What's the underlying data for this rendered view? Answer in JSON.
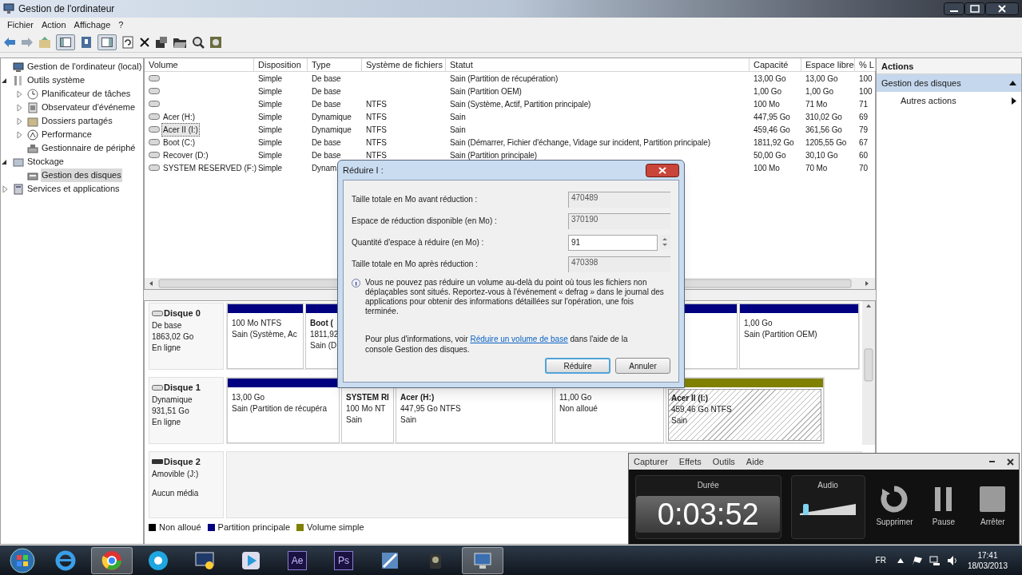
{
  "window": {
    "title": "Gestion de l'ordinateur"
  },
  "menu": [
    "Fichier",
    "Action",
    "Affichage",
    "?"
  ],
  "toolbar": {
    "console_tree_shown": true,
    "action_pane_shown": true
  },
  "tree": [
    {
      "label": "Gestion de l'ordinateur (local)",
      "kind": "computer",
      "selected": false,
      "children": [
        {
          "label": "Outils système",
          "kind": "tools",
          "expanded": true,
          "selected": false,
          "children": [
            {
              "label": "Planificateur de tâches",
              "kind": "clock",
              "expanded": false,
              "selected": false
            },
            {
              "label": "Observateur d'événeme",
              "kind": "log",
              "expanded": false,
              "selected": false
            },
            {
              "label": "Dossiers partagés",
              "kind": "share",
              "expanded": false,
              "selected": false
            },
            {
              "label": "Performance",
              "kind": "perf",
              "expanded": false,
              "selected": false
            },
            {
              "label": "Gestionnaire de périphé",
              "kind": "devices",
              "selected": false
            }
          ]
        },
        {
          "label": "Stockage",
          "kind": "storage",
          "expanded": true,
          "selected": false,
          "children": [
            {
              "label": "Gestion des disques",
              "kind": "disk",
              "selected": true
            }
          ]
        },
        {
          "label": "Services et applications",
          "kind": "services",
          "expanded": false,
          "selected": false
        }
      ]
    }
  ],
  "table": {
    "columns": [
      "Volume",
      "Disposition",
      "Type",
      "Système de fichiers",
      "Statut",
      "Capacité",
      "Espace libre",
      "% L"
    ],
    "rows": [
      {
        "selected": false,
        "layout": "Simple",
        "type": "De base",
        "status": "Sain (Partition de récupération)",
        "capacity": "13,00 Go",
        "free": "13,00 Go",
        "pct": "100"
      },
      {
        "selected": false,
        "layout": "Simple",
        "type": "De base",
        "status": "Sain (Partition OEM)",
        "capacity": "1,00 Go",
        "free": "1,00 Go",
        "pct": "100"
      },
      {
        "selected": false,
        "layout": "Simple",
        "type": "De base",
        "fs": "NTFS",
        "status": "Sain (Système, Actif, Partition principale)",
        "capacity": "100 Mo",
        "free": "71 Mo",
        "pct": "71"
      },
      {
        "selected": false,
        "volume": "Acer (H:)",
        "layout": "Simple",
        "type": "Dynamique",
        "fs": "NTFS",
        "status": "Sain",
        "capacity": "447,95 Go",
        "free": "310,02 Go",
        "pct": "69"
      },
      {
        "selected": true,
        "volume": "Acer II (I:)",
        "layout": "Simple",
        "type": "Dynamique",
        "fs": "NTFS",
        "status": "Sain",
        "capacity": "459,46 Go",
        "free": "361,56 Go",
        "pct": "79"
      },
      {
        "selected": false,
        "volume": "Boot (C:)",
        "layout": "Simple",
        "type": "De base",
        "fs": "NTFS",
        "status": "Sain (Démarrer, Fichier d'échange, Vidage sur incident, Partition principale)",
        "capacity": "1811,92 Go",
        "free": "1205,55 Go",
        "pct": "67"
      },
      {
        "selected": false,
        "volume": "Recover (D:)",
        "layout": "Simple",
        "type": "De base",
        "fs": "NTFS",
        "status": "Sain (Partition principale)",
        "capacity": "50,00 Go",
        "free": "30,10 Go",
        "pct": "60"
      },
      {
        "selected": false,
        "volume": "SYSTEM RESERVED (F:)",
        "layout": "Simple",
        "type": "Dynam",
        "capacity": "100 Mo",
        "free": "70 Mo",
        "pct": "70"
      }
    ]
  },
  "disks": [
    {
      "kind": "hdd",
      "name": "Disque 0",
      "lines": [
        "De base",
        "1863,02 Go",
        "En ligne"
      ],
      "partitions": [
        {
          "color": "#000080",
          "selected": false,
          "lines": [
            "100 Mo NTFS",
            "Sain (Système, Ac"
          ]
        },
        {
          "color": "#000080",
          "selected": false,
          "name": "Boot (",
          "lines": [
            "1811,92",
            "Sain (D"
          ]
        },
        {
          "color": "#000080",
          "selected": false
        },
        {
          "color": "#000080",
          "selected": false,
          "lines": [
            "1,00 Go",
            "Sain (Partition OEM)"
          ]
        }
      ]
    },
    {
      "kind": "hdd",
      "name": "Disque 1",
      "lines": [
        "Dynamique",
        "931,51 Go",
        "En ligne"
      ],
      "partitions": [
        {
          "color": "#000080",
          "selected": false,
          "lines": [
            "13,00 Go",
            "Sain (Partition de récupéra"
          ]
        },
        {
          "selected": false,
          "name": "SYSTEM RI",
          "lines": [
            "100 Mo NT",
            "Sain"
          ]
        },
        {
          "selected": false,
          "name": "Acer  (H:)",
          "lines": [
            "447,95 Go NTFS",
            "Sain"
          ]
        },
        {
          "selected": false,
          "lines": [
            "11,00 Go",
            "Non alloué"
          ]
        },
        {
          "color": "#808000",
          "selected": true,
          "name": "Acer II  (I:)",
          "lines": [
            "459,46 Go NTFS",
            "Sain"
          ]
        }
      ]
    },
    {
      "kind": "removable",
      "name": "Disque 2",
      "lines": [
        "Amovible (J:)",
        "Aucun média"
      ]
    }
  ],
  "legend": [
    {
      "label": "Non alloué",
      "color": "#000000"
    },
    {
      "label": "Partition principale",
      "color": "#000080"
    },
    {
      "label": "Volume simple",
      "color": "#808000"
    }
  ],
  "actions": {
    "title": "Actions",
    "items": [
      {
        "kind": "section",
        "label": "Gestion des disques",
        "selected": true
      },
      {
        "kind": "submenu",
        "label": "Autres actions",
        "selected": false
      }
    ]
  },
  "dialog": {
    "title": "Réduire I :",
    "fields": [
      {
        "kind": "readonly",
        "label": "Taille totale en Mo avant réduction :",
        "value": "470489"
      },
      {
        "kind": "readonly",
        "label": "Espace de réduction disponible (en Mo) :",
        "value": "370190"
      },
      {
        "kind": "spin",
        "label": "Quantité d'espace à réduire (en Mo) :",
        "value": "91"
      },
      {
        "kind": "readonly",
        "label": "Taille totale en Mo après réduction :",
        "value": "470398"
      }
    ],
    "info": "Vous ne pouvez pas réduire un volume au-delà du point où tous les fichiers non déplaçables sont situés. Reportez-vous à l'événement « defrag » dans le journal des applications pour obtenir des informations détaillées sur l'opération, une fois terminée.",
    "help": {
      "before": "Pour plus d'informations, voir ",
      "link": "Réduire un volume de base",
      "after": " dans l'aide de la console Gestion des disques."
    },
    "buttons": [
      {
        "label": "Réduire",
        "default": true
      },
      {
        "label": "Annuler",
        "default": false
      }
    ]
  },
  "recorder": {
    "menu": [
      "Capturer",
      "Effets",
      "Outils",
      "Aide"
    ],
    "duration_label": "Durée",
    "duration": "0:03:52",
    "audio_label": "Audio",
    "audio": {
      "level": 0.08
    },
    "buttons": [
      {
        "kind": "delete",
        "label": "Supprimer"
      },
      {
        "kind": "pause",
        "label": "Pause"
      },
      {
        "kind": "stop",
        "label": "Arrêter"
      }
    ]
  },
  "taskbar": {
    "apps": [
      {
        "kind": "ie",
        "selected": false
      },
      {
        "kind": "chrome",
        "selected": true
      },
      {
        "kind": "skype",
        "selected": false
      },
      {
        "kind": "remote",
        "selected": false
      },
      {
        "kind": "player",
        "selected": false
      },
      {
        "kind": "tile",
        "label": "Ae",
        "selected": false
      },
      {
        "kind": "tile",
        "label": "Ps",
        "selected": false
      },
      {
        "kind": "pen",
        "selected": false
      },
      {
        "kind": "camera",
        "selected": false
      },
      {
        "kind": "computer",
        "selected": true
      }
    ],
    "language": "FR",
    "time": "17:41",
    "date": "18/03/2013"
  }
}
